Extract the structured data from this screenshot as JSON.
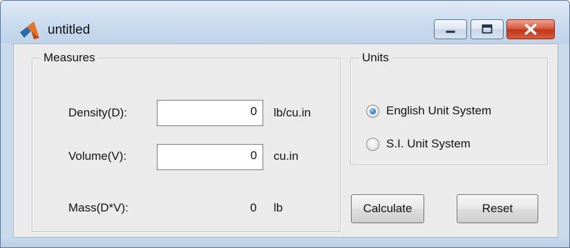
{
  "window": {
    "title": "untitled",
    "controls": {
      "minimize_icon": "minimize-icon",
      "maximize_icon": "maximize-icon",
      "close_icon": "close-icon"
    },
    "app_icon": "matlab-logo-icon"
  },
  "measures": {
    "legend": "Measures",
    "density": {
      "label": "Density(D):",
      "value": "0",
      "unit": "lb/cu.in"
    },
    "volume": {
      "label": "Volume(V):",
      "value": "0",
      "unit": "cu.in"
    },
    "mass": {
      "label": "Mass(D*V):",
      "value": "0",
      "unit": "lb"
    }
  },
  "units": {
    "legend": "Units",
    "options": [
      {
        "label": "English Unit System",
        "selected": true
      },
      {
        "label": "S.I. Unit System",
        "selected": false
      }
    ]
  },
  "buttons": {
    "calculate": "Calculate",
    "reset": "Reset"
  },
  "colors": {
    "close_button": "#c2351b",
    "radio_selected": "#2f7fc7"
  }
}
